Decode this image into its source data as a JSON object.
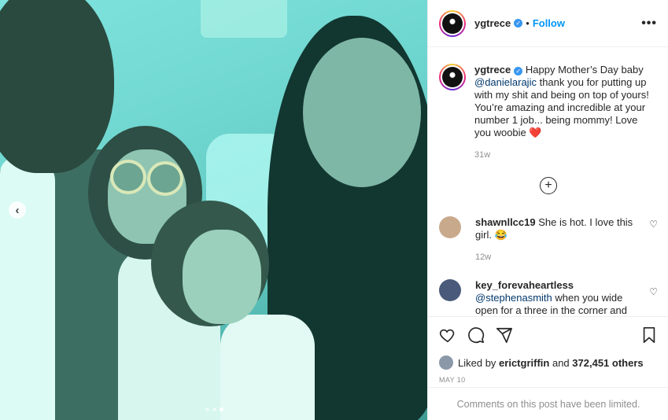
{
  "post": {
    "author": "ygtrece",
    "follow_label": "Follow",
    "separator": "•",
    "more_label": "•••",
    "caption": {
      "username": "ygtrece",
      "text_before": "Happy Mother’s Day baby ",
      "mention": "@danielarajic",
      "text_after": " thank you for putting up with my shit and being on top of yours! You’re amazing and incredible at your number 1 job... being mommy! Love you woobie",
      "emoji": "❤️",
      "age": "31w"
    },
    "load_more_label": "+",
    "comments": [
      {
        "username": "shawnllcc19",
        "text": "She is hot. I love this girl. 😂",
        "age": "12w",
        "avatar_color": "#c9a98c"
      },
      {
        "username": "key_forevaheartless",
        "mention": "@stephenasmith",
        "text": "when you wide open for a three in the corner and",
        "avatar_color": "#4a5a7a"
      }
    ],
    "likes": {
      "prefix": "Liked by",
      "user": "erictgriffin",
      "and": "and",
      "count": "372,451 others"
    },
    "date": "MAY 10",
    "comments_limited": "Comments on this post have been limited."
  },
  "photo": {
    "prev_arrow": "‹",
    "carousel_dots": 3,
    "active_dot": 2
  },
  "colors": {
    "accent": "#0095f6",
    "verified": "#3897f0",
    "secondary_text": "#8e8e8e"
  },
  "icons": [
    "verified-badge-icon",
    "more-options-icon",
    "chevron-left-icon",
    "plus-circle-icon",
    "heart-icon",
    "comment-icon",
    "share-icon",
    "bookmark-icon"
  ]
}
